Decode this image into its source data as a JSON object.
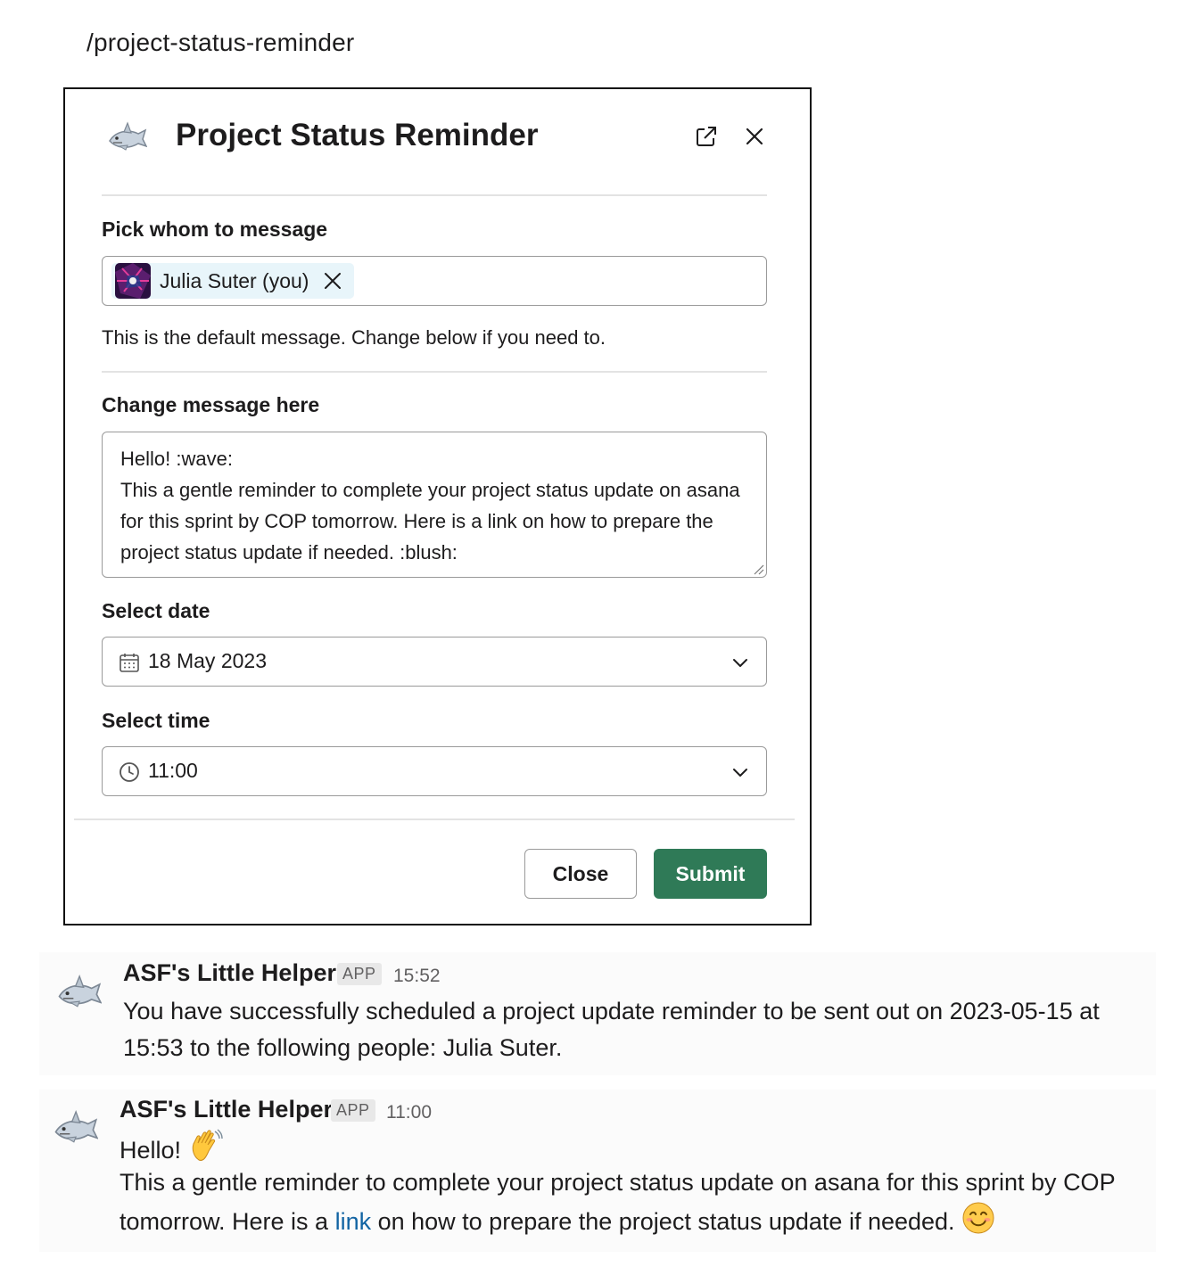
{
  "command": "/project-status-reminder",
  "modal": {
    "title": "Project Status Reminder",
    "recipients": {
      "label": "Pick whom to message",
      "selected": [
        {
          "name": "Julia Suter (you)"
        }
      ]
    },
    "helper_text": "This is the default message. Change below if you need to.",
    "message": {
      "label": "Change message here",
      "value": "Hello! :wave:\nThis a gentle reminder to complete your project status update on asana for this sprint by COP tomorrow. Here is a link on how to prepare the project status update if needed. :blush:"
    },
    "date": {
      "label": "Select date",
      "value": "18 May 2023",
      "icon": "calendar-icon"
    },
    "time": {
      "label": "Select time",
      "value": "11:00",
      "icon": "clock-icon"
    },
    "buttons": {
      "close": "Close",
      "submit": "Submit"
    },
    "colors": {
      "submit": "#2f7a57"
    }
  },
  "messages": [
    {
      "sender": "ASF's Little Helper",
      "badge": "APP",
      "time": "15:52",
      "text": "You have successfully scheduled a project update reminder to be sent out on 2023-05-15 at 15:53 to the following people: Julia Suter."
    },
    {
      "sender": "ASF's Little Helper",
      "badge": "APP",
      "time": "11:00",
      "greeting": "Hello!",
      "text_before_link": "This a gentle reminder to complete your project status update on asana for this sprint by COP tomorrow. Here is a ",
      "link_text": "link",
      "text_after_link": " on how to prepare the project status update if needed."
    }
  ],
  "colors": {
    "link": "#1264a3",
    "accent": "#2f7a57"
  }
}
